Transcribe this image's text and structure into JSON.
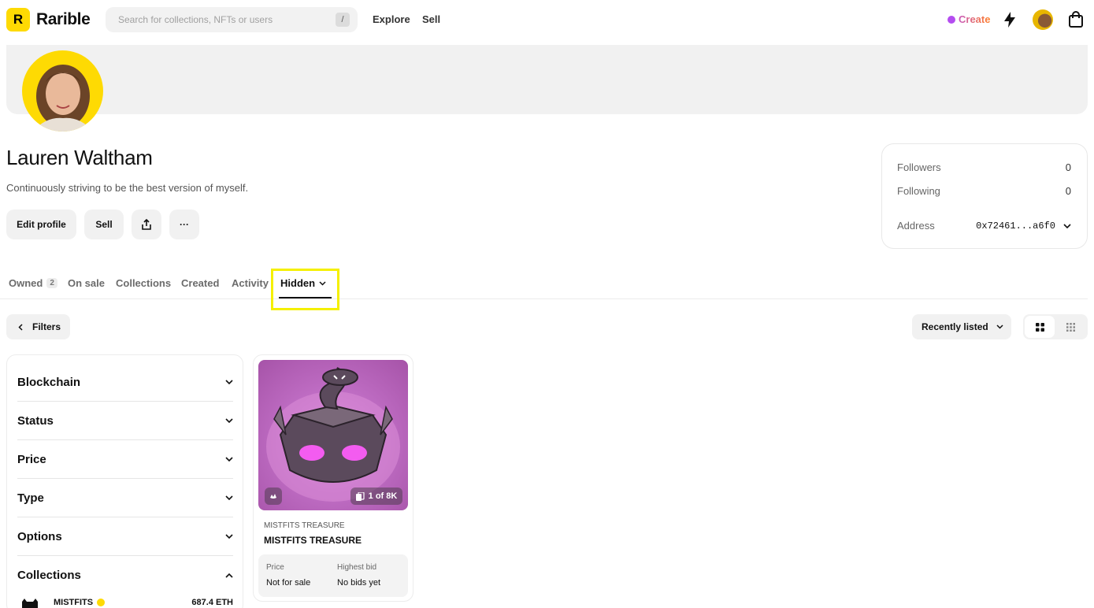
{
  "header": {
    "logo_mark": "R",
    "brand": "Rarible",
    "search_placeholder": "Search for collections, NFTs or users",
    "search_shortcut": "/",
    "nav": [
      "Explore",
      "Sell"
    ],
    "create_label": "Create",
    "icons": [
      "activity-bolt-icon",
      "user-avatar",
      "cart-bag-icon"
    ]
  },
  "profile": {
    "name": "Lauren Waltham",
    "bio": "Continuously striving to be the best version of myself.",
    "buttons": {
      "edit": "Edit profile",
      "sell": "Sell",
      "share_icon": "share-icon",
      "more": "···"
    }
  },
  "stats": {
    "followers_label": "Followers",
    "followers_value": "0",
    "following_label": "Following",
    "following_value": "0",
    "address_label": "Address",
    "address_value": "0x72461...a6f0"
  },
  "tabs": [
    {
      "label": "Owned",
      "count": "2"
    },
    {
      "label": "On sale"
    },
    {
      "label": "Collections"
    },
    {
      "label": "Created"
    },
    {
      "label": "Activity"
    },
    {
      "label": "Hidden",
      "active": true
    }
  ],
  "toolbar": {
    "filters_label": "Filters",
    "sort_label": "Recently listed"
  },
  "filters": {
    "facets": [
      "Blockchain",
      "Status",
      "Price",
      "Type",
      "Options",
      "Collections"
    ],
    "collections": [
      {
        "name": "MISTFITS",
        "verified": true,
        "value": "687.4 ETH"
      }
    ]
  },
  "card": {
    "collection": "MISTFITS TREASURE",
    "title": "MISTFITS TREASURE",
    "edition": "1 of 8K",
    "price_label": "Price",
    "price_value": "Not for sale",
    "bid_label": "Highest bid",
    "bid_value": "No bids yet"
  },
  "colors": {
    "brand_yellow": "#FEDA03",
    "highlight": "#F5F000",
    "create_start": "#B44CF0",
    "create_end": "#FF7F2A"
  }
}
